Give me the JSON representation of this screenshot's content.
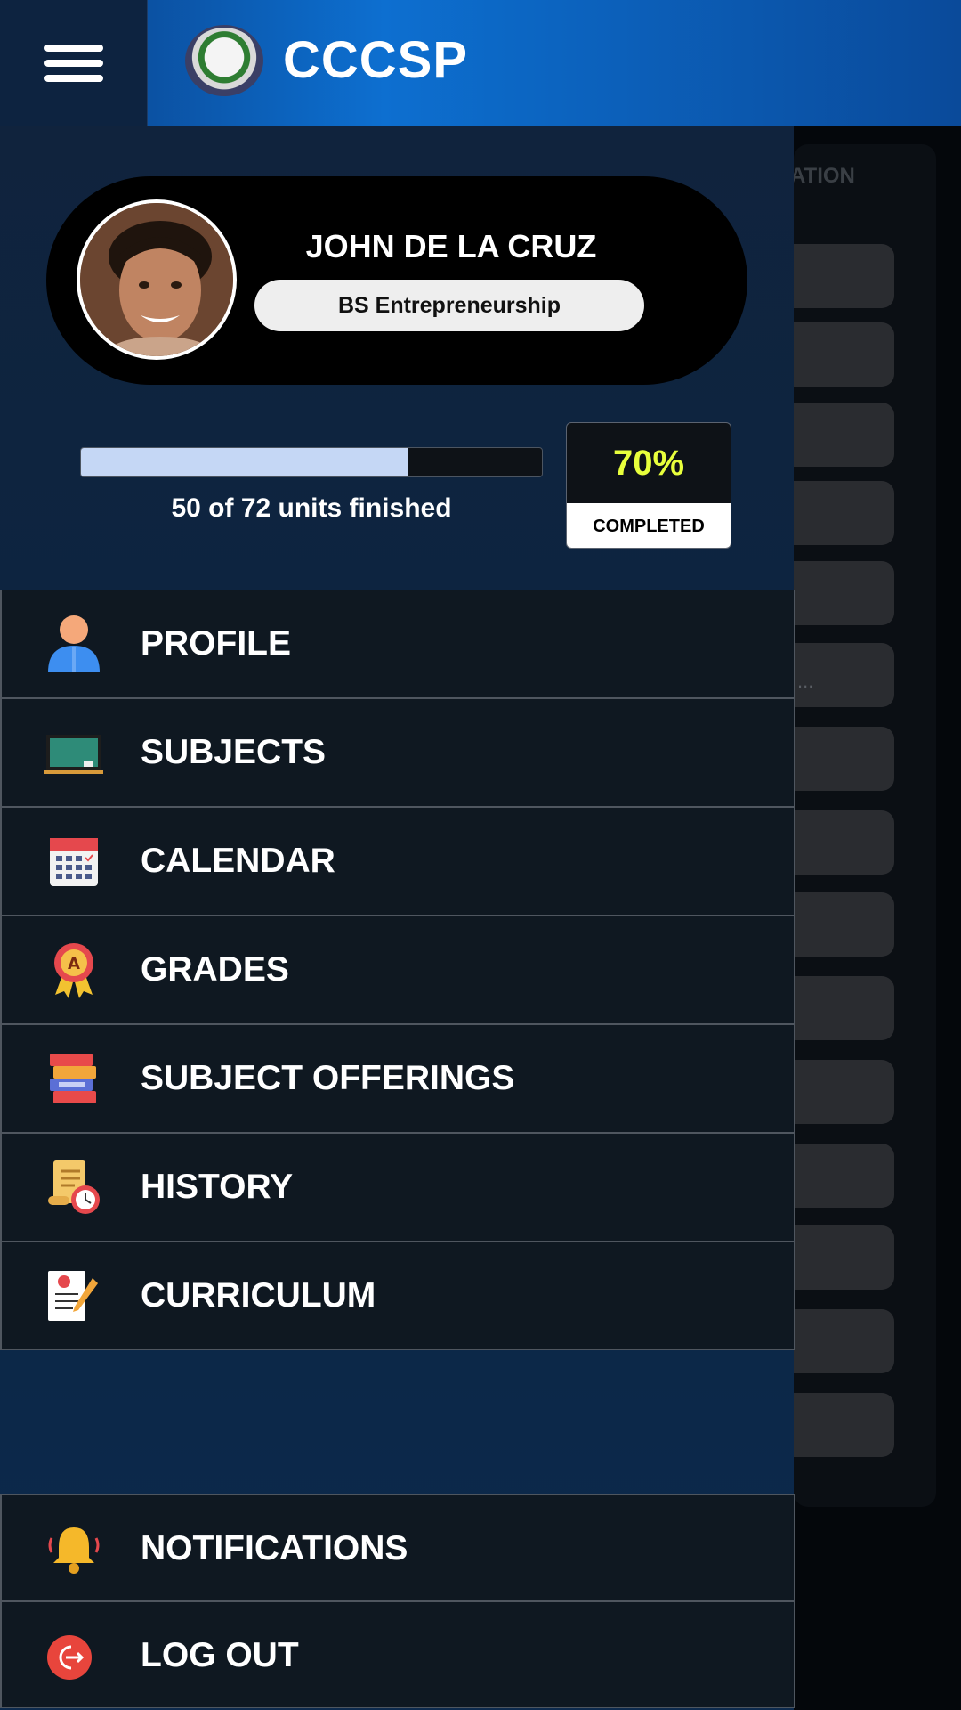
{
  "app": {
    "title": "CCCSP"
  },
  "background": {
    "tab_fragment": "ATION",
    "ellipsis": "..."
  },
  "profile": {
    "name": "JOHN DE LA CRUZ",
    "program": "BS Entrepreneurship",
    "progress_text": "50 of 72 units finished",
    "progress_fraction": 0.71,
    "percent_value": "70%",
    "percent_label": "COMPLETED"
  },
  "menu": [
    {
      "label": "PROFILE",
      "icon": "person-icon"
    },
    {
      "label": "SUBJECTS",
      "icon": "chalkboard-icon"
    },
    {
      "label": "CALENDAR",
      "icon": "calendar-icon"
    },
    {
      "label": "GRADES",
      "icon": "award-ribbon-icon"
    },
    {
      "label": "SUBJECT OFFERINGS",
      "icon": "books-icon"
    },
    {
      "label": "HISTORY",
      "icon": "scroll-clock-icon"
    },
    {
      "label": "CURRICULUM",
      "icon": "document-pen-icon"
    }
  ],
  "bottom_menu": [
    {
      "label": "NOTIFICATIONS",
      "icon": "bell-icon"
    },
    {
      "label": "LOG OUT",
      "icon": "logout-icon"
    }
  ],
  "colors": {
    "accent": "#e8ff3c",
    "drawer": "#10233d",
    "appbar": "#0d6fd0"
  }
}
